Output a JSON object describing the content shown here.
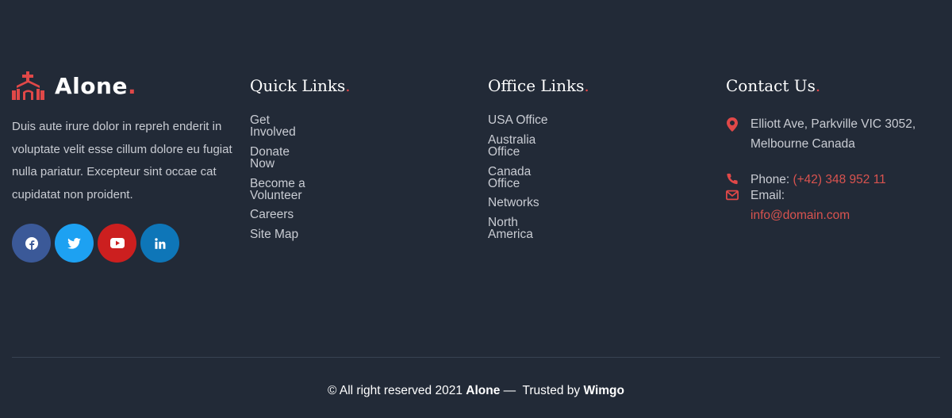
{
  "brand": {
    "name": "Alone",
    "dot": ".",
    "accent": "#e04848"
  },
  "about": "Duis aute irure dolor in repreh enderit in voluptate velit esse cillum dolore eu fugiat nulla pariatur. Excepteur sint occae cat cupidatat non proident.",
  "socials": [
    {
      "icon": "facebook-icon",
      "color": "#3b5998"
    },
    {
      "icon": "twitter-icon",
      "color": "#1da1f2"
    },
    {
      "icon": "youtube-icon",
      "color": "#cc1f1f"
    },
    {
      "icon": "linkedin-icon",
      "color": "#0e76b8"
    }
  ],
  "quick_links": {
    "title": "Quick Links",
    "dot": ".",
    "items": [
      "Get Involved",
      "Donate Now",
      "Become a Volunteer",
      "Careers",
      "Site Map"
    ]
  },
  "office_links": {
    "title": "Office Links",
    "dot": ".",
    "items": [
      "USA Office",
      "Australia Office",
      "Canada Office",
      "Networks",
      "North America"
    ]
  },
  "contact": {
    "title": "Contact Us",
    "dot": ".",
    "address": "Elliott Ave, Parkville VIC 3052, Melbourne Canada",
    "phone_label": "Phone:",
    "phone_value": "(+42) 348 952 11",
    "email_label": "Email:",
    "email_value": "info@domain.com"
  },
  "footer": {
    "prefix": "© All right reserved 2021",
    "brand": "Alone",
    "separator": "—",
    "trusted": "Trusted by",
    "partner": "Wimgo"
  }
}
